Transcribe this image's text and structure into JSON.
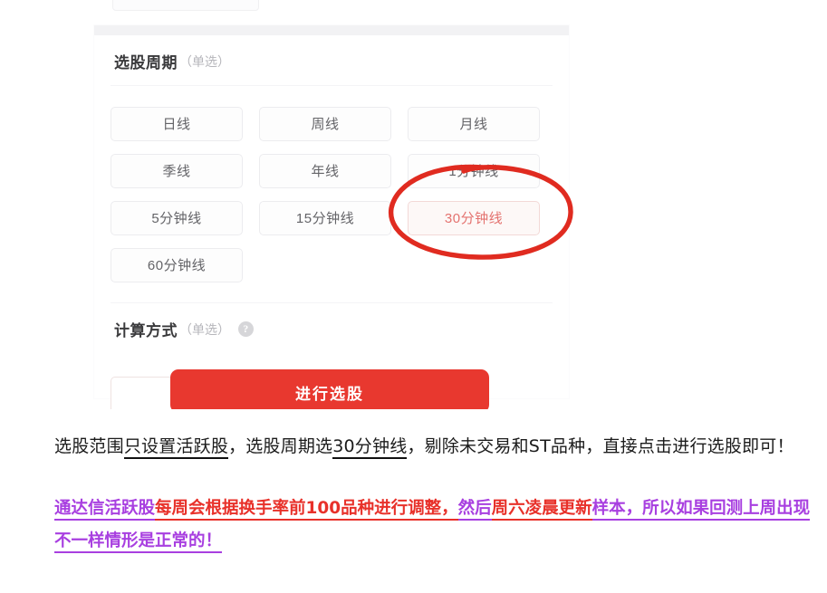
{
  "app": {
    "cycle_section": {
      "title": "选股周期",
      "title_note": "（单选）",
      "options": [
        {
          "label": "日线",
          "selected": false
        },
        {
          "label": "周线",
          "selected": false
        },
        {
          "label": "月线",
          "selected": false
        },
        {
          "label": "季线",
          "selected": false
        },
        {
          "label": "年线",
          "selected": false
        },
        {
          "label": "1分钟线",
          "selected": false
        },
        {
          "label": "5分钟线",
          "selected": false
        },
        {
          "label": "15分钟线",
          "selected": false
        },
        {
          "label": "30分钟线",
          "selected": true
        },
        {
          "label": "60分钟线",
          "selected": false
        }
      ]
    },
    "calc_section": {
      "title": "计算方式",
      "title_note": "（单选）",
      "help_icon": "question-mark-icon",
      "help_glyph": "?"
    },
    "cta": {
      "label": "进行选股"
    },
    "annotation": {
      "type": "hand-drawn-ellipse",
      "color": "#e02b20",
      "targets": "30分钟线"
    }
  },
  "prose": {
    "paragraph_1": {
      "seg_1": "选股范围",
      "seg_2_underlined": "只设置活跃股",
      "seg_3": "，选股周期选",
      "seg_4_underlined": "30分钟线",
      "seg_5": "，剔除未交易和ST品种，直接点击进行选股即可！"
    },
    "paragraph_2": {
      "seg_1_purple": "通达信活跃股",
      "seg_2_red": "每周会根据换手率前100品种进行调整，",
      "seg_3_purple": "然后",
      "seg_4_red": "周六凌晨更新",
      "seg_5_purple": "样本，所以如果回测上周出现不一样情形是正常的！"
    }
  },
  "colors": {
    "accent_red": "#e8382f",
    "selected_text": "#e4726f",
    "annotation_red": "#e02b20",
    "prose_red": "#e8312a",
    "prose_purple": "#a83fe0"
  }
}
